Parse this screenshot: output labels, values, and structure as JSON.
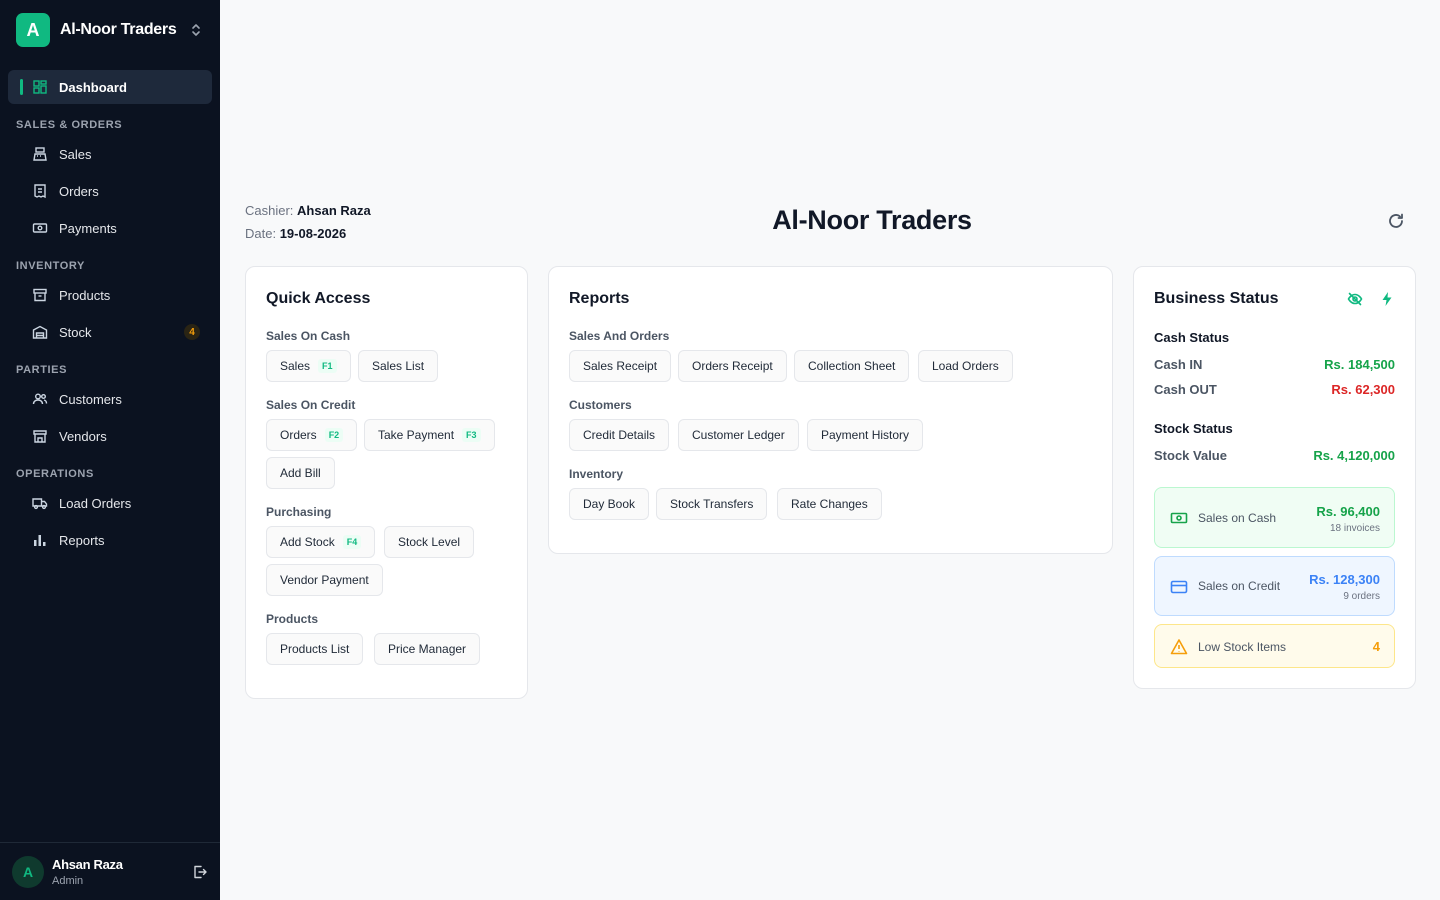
{
  "brand": {
    "logo_letter": "A",
    "name": "Al-Noor Traders",
    "accent": "#10b981"
  },
  "sidebar": {
    "dashboard": "Dashboard",
    "sections": {
      "sales_orders": "SALES & ORDERS",
      "inventory": "INVENTORY",
      "parties": "PARTIES",
      "operations": "OPERATIONS"
    },
    "items": {
      "sales": "Sales",
      "orders": "Orders",
      "payments": "Payments",
      "products": "Products",
      "stock": "Stock",
      "stock_badge": "4",
      "customers": "Customers",
      "vendors": "Vendors",
      "load_orders": "Load Orders",
      "reports": "Reports"
    },
    "user": {
      "initial": "A",
      "name": "Ahsan Raza",
      "role": "Admin"
    }
  },
  "header": {
    "cashier_label": "Cashier:",
    "cashier_name": "Ahsan Raza",
    "date_label": "Date:",
    "date_value": "19-08-2026",
    "title": "Al-Noor Traders"
  },
  "quick_access": {
    "title": "Quick Access",
    "groups": {
      "sales_on_cash": "Sales On Cash",
      "sales_on_credit": "Sales On Credit",
      "purchasing": "Purchasing",
      "products": "Products"
    },
    "buttons": {
      "sales": "Sales",
      "sales_key": "F1",
      "sales_list": "Sales List",
      "orders": "Orders",
      "orders_key": "F2",
      "take_payment": "Take Payment",
      "take_payment_key": "F3",
      "add_bill": "Add Bill",
      "add_stock": "Add Stock",
      "add_stock_key": "F4",
      "stock_level": "Stock Level",
      "vendor_payment": "Vendor Payment",
      "products_list": "Products List",
      "price_manager": "Price Manager"
    }
  },
  "reports": {
    "title": "Reports",
    "groups": {
      "sales_and_orders": "Sales And Orders",
      "customers": "Customers",
      "inventory": "Inventory"
    },
    "buttons": {
      "sales_receipt": "Sales Receipt",
      "orders_receipt": "Orders Receipt",
      "collection_sheet": "Collection Sheet",
      "load_orders": "Load Orders",
      "credit_details": "Credit Details",
      "customer_ledger": "Customer Ledger",
      "payment_history": "Payment History",
      "day_book": "Day Book",
      "stock_transfers": "Stock Transfers",
      "rate_changes": "Rate Changes"
    }
  },
  "business_status": {
    "title": "Business Status",
    "cash_status": "Cash Status",
    "cash_in_label": "Cash IN",
    "cash_in_value": "Rs. 184,500",
    "cash_out_label": "Cash OUT",
    "cash_out_value": "Rs. 62,300",
    "stock_status": "Stock Status",
    "stock_value_label": "Stock Value",
    "stock_value": "Rs. 4,120,000",
    "tiles": {
      "cash_label": "Sales on Cash",
      "cash_value": "Rs. 96,400",
      "cash_sub": "18 invoices",
      "credit_label": "Sales on Credit",
      "credit_value": "Rs. 128,300",
      "credit_sub": "9 orders",
      "low_label": "Low Stock Items",
      "low_value": "4"
    },
    "colors": {
      "positive": "#16a34a",
      "negative": "#dc2626",
      "credit": "#3b82f6",
      "warning": "#f59e0b"
    }
  }
}
